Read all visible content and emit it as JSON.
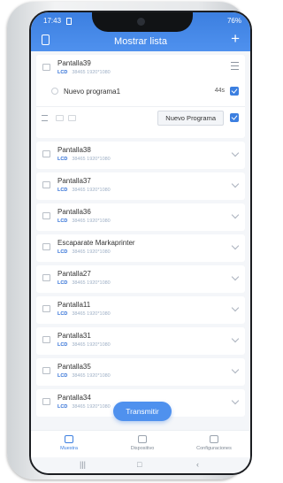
{
  "status": {
    "time": "17:43",
    "battery": "76%"
  },
  "header": {
    "title": "Mostrar lista"
  },
  "expanded_screen": {
    "name": "Pantalla39",
    "lcd": "LCD",
    "spec": "38465 1920*1080",
    "program": {
      "name": "Nuevo programa1",
      "duration": "44s"
    },
    "new_program_label": "Nuevo Programa"
  },
  "screens": [
    {
      "name": "Pantalla38",
      "lcd": "LCD",
      "spec": "38465 1920*1080"
    },
    {
      "name": "Pantalla37",
      "lcd": "LCD",
      "spec": "38465 1920*1080"
    },
    {
      "name": "Pantalla36",
      "lcd": "LCD",
      "spec": "38465 1920*1080"
    },
    {
      "name": "Escaparate Markaprinter",
      "lcd": "LCD",
      "spec": "38465 1920*1080"
    },
    {
      "name": "Pantalla27",
      "lcd": "LCD",
      "spec": "38465 1920*1080"
    },
    {
      "name": "Pantalla11",
      "lcd": "LCD",
      "spec": "38465 1920*1080"
    },
    {
      "name": "Pantalla31",
      "lcd": "LCD",
      "spec": "38465 1920*1080"
    },
    {
      "name": "Pantalla35",
      "lcd": "LCD",
      "spec": "38465 1920*1080"
    },
    {
      "name": "Pantalla34",
      "lcd": "LCD",
      "spec": "38465 1920*1080"
    }
  ],
  "transmit_label": "Transmitir",
  "nav": [
    {
      "label": "Muestra",
      "icon": "layers-icon",
      "active": true
    },
    {
      "label": "Dispositivo",
      "icon": "monitor-icon",
      "active": false
    },
    {
      "label": "Configuraciones",
      "icon": "gear-icon",
      "active": false
    }
  ],
  "colors": {
    "accent": "#3c7fe0",
    "header": "#4f91ee"
  }
}
